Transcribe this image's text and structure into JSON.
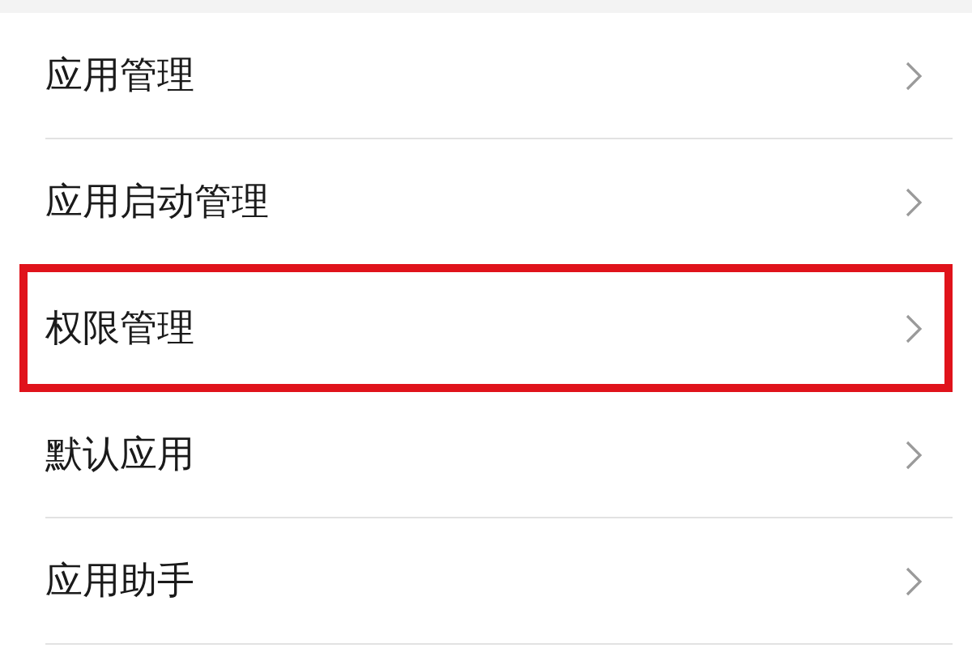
{
  "settings_list": [
    {
      "label": "应用管理",
      "highlighted": false
    },
    {
      "label": "应用启动管理",
      "highlighted": false
    },
    {
      "label": "权限管理",
      "highlighted": true
    },
    {
      "label": "默认应用",
      "highlighted": false
    },
    {
      "label": "应用助手",
      "highlighted": false
    }
  ]
}
